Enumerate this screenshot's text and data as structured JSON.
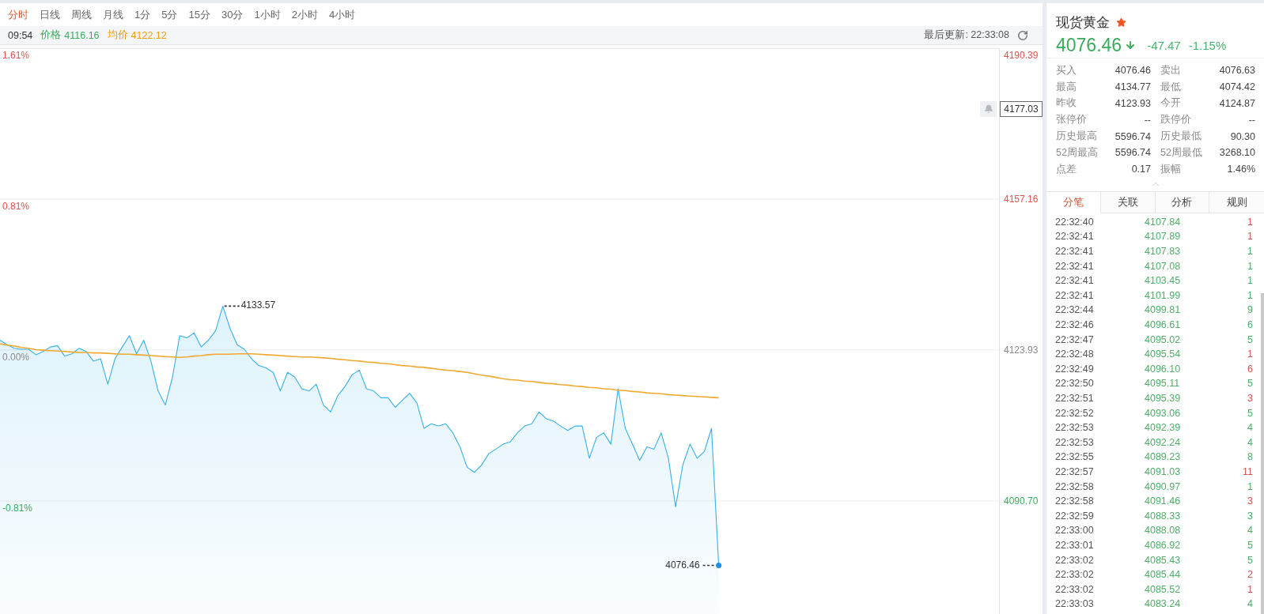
{
  "chart_tabs": [
    {
      "label": "分时",
      "selected": true
    },
    {
      "label": "日线",
      "selected": false
    },
    {
      "label": "周线",
      "selected": false
    },
    {
      "label": "月线",
      "selected": false
    },
    {
      "label": "1分",
      "selected": false
    },
    {
      "label": "5分",
      "selected": false
    },
    {
      "label": "15分",
      "selected": false
    },
    {
      "label": "30分",
      "selected": false
    },
    {
      "label": "1小时",
      "selected": false
    },
    {
      "label": "2小时",
      "selected": false
    },
    {
      "label": "4小时",
      "selected": false
    }
  ],
  "info_bar": {
    "time": "09:54",
    "readings": [
      "4116.16",
      "4122.12"
    ],
    "last_update": "最后更新: 22:33:08"
  },
  "chart": {
    "cursor_price": "4177.03",
    "percent_labels": [
      {
        "label": "1.61%",
        "color": "#e5514e"
      },
      {
        "label": "0.81%",
        "color": "#e5514e"
      },
      {
        "label": "0.00%",
        "color": "#8a8a8a"
      },
      {
        "label": "-0.81%",
        "color": "#3aac5d"
      }
    ],
    "chart_data": {
      "type": "line",
      "grid": true,
      "ylim": [
        4065.8,
        4190.39
      ],
      "yticks": [
        {
          "value": 4190.39,
          "label": "4190.39"
        },
        {
          "value": 4157.16,
          "label": "4157.16"
        },
        {
          "value": 4123.93,
          "label": "4123.93"
        },
        {
          "value": 4090.7,
          "label": "4090.70"
        }
      ],
      "series": [
        {
          "name": "价格",
          "color": "#38b0e8",
          "values": [
            4126.1,
            4125.1,
            4124.3,
            4124.1,
            4124.1,
            4122.9,
            4123.6,
            4124.6,
            4124.9,
            4122.6,
            4123.1,
            4124.3,
            4123.6,
            4121.5,
            4122.0,
            4116.4,
            4122.0,
            4124.6,
            4127.1,
            4123.1,
            4126.1,
            4121.5,
            4114.9,
            4111.8,
            4118.0,
            4127.1,
            4126.6,
            4127.7,
            4124.6,
            4126.1,
            4128.2,
            4133.6,
            4128.7,
            4125.1,
            4124.1,
            4122.0,
            4120.5,
            4120.0,
            4119.0,
            4114.9,
            4119.0,
            4118.0,
            4115.4,
            4114.9,
            4116.4,
            4111.8,
            4110.3,
            4113.9,
            4115.9,
            4118.5,
            4119.5,
            4115.4,
            4114.9,
            4113.4,
            4113.4,
            4111.3,
            4112.9,
            4114.4,
            4112.3,
            4106.7,
            4107.7,
            4107.2,
            4107.7,
            4105.7,
            4102.6,
            4098.1,
            4097.0,
            4098.6,
            4101.1,
            4102.1,
            4103.2,
            4103.7,
            4105.7,
            4107.2,
            4107.7,
            4110.3,
            4108.8,
            4108.3,
            4107.2,
            4106.2,
            4107.2,
            4107.2,
            4100.1,
            4104.7,
            4105.7,
            4103.2,
            4115.4,
            4106.7,
            4103.2,
            4099.6,
            4102.6,
            4102.1,
            4105.7,
            4100.1,
            4089.4,
            4098.6,
            4103.2,
            4100.1,
            4101.6,
            4106.7,
            4076.5,
            null,
            null,
            null,
            null,
            null,
            null,
            null,
            null,
            null,
            null,
            null,
            null,
            null,
            null,
            null,
            null,
            null,
            null,
            null,
            null,
            null,
            null,
            null,
            null,
            null,
            null,
            null,
            null,
            null,
            null,
            null,
            null,
            null,
            null,
            null,
            null,
            null,
            null,
            null
          ]
        },
        {
          "name": "均价",
          "color": "#f0a830",
          "values": [
            4125.3,
            4125.0,
            4124.8,
            4124.5,
            4124.3,
            4124.0,
            4123.9,
            4123.8,
            4123.7,
            4123.6,
            4123.5,
            4123.4,
            4123.4,
            4123.3,
            4123.3,
            4123.2,
            4123.1,
            4123.0,
            4123.0,
            4122.9,
            4122.8,
            4122.7,
            4122.6,
            4122.5,
            4122.4,
            4122.3,
            4122.4,
            4122.6,
            4122.7,
            4122.9,
            4123.0,
            4123.0,
            4123.0,
            4123.1,
            4123.1,
            4123.1,
            4123.0,
            4122.9,
            4122.8,
            4122.7,
            4122.6,
            4122.5,
            4122.4,
            4122.4,
            4122.3,
            4122.2,
            4122.1,
            4121.9,
            4121.8,
            4121.6,
            4121.5,
            4121.3,
            4121.2,
            4121.0,
            4120.9,
            4120.7,
            4120.5,
            4120.4,
            4120.2,
            4120.1,
            4119.9,
            4119.7,
            4119.5,
            4119.4,
            4119.2,
            4119.0,
            4118.7,
            4118.4,
            4118.2,
            4117.9,
            4117.6,
            4117.4,
            4117.3,
            4117.1,
            4117.0,
            4116.8,
            4116.6,
            4116.5,
            4116.3,
            4116.2,
            4116.0,
            4115.9,
            4115.7,
            4115.6,
            4115.4,
            4115.3,
            4115.1,
            4115.0,
            4114.8,
            4114.7,
            4114.5,
            4114.4,
            4114.3,
            4114.1,
            4114.0,
            4113.9,
            4113.8,
            4113.7,
            4113.6,
            4113.5,
            4113.4,
            null,
            null,
            null,
            null,
            null,
            null,
            null,
            null,
            null,
            null,
            null,
            null,
            null,
            null,
            null,
            null,
            null,
            null,
            null,
            null,
            null,
            null,
            null,
            null,
            null,
            null,
            null,
            null,
            null,
            null,
            null,
            null,
            null,
            null,
            null,
            null,
            null,
            null,
            null
          ]
        }
      ],
      "annotations": [
        "4133.57",
        "4076.46"
      ]
    }
  },
  "quote": {
    "name": "现货黄金",
    "favorite": true,
    "falling": true,
    "price": "4076.46",
    "change": "-47.47",
    "change_pct": "-1.15%"
  },
  "stat_rows": [
    [
      "买入",
      "4076.46",
      "卖出",
      "4076.63"
    ],
    [
      "最高",
      "4134.77",
      "最低",
      "4074.42"
    ],
    [
      "昨收",
      "4123.93",
      "今开",
      "4124.87"
    ],
    [
      "张停价",
      "--",
      "跌停价",
      "--"
    ],
    [
      "历史最高",
      "5596.74",
      "历史最低",
      "90.30"
    ],
    [
      "52周最高",
      "5596.74",
      "52周最低",
      "3268.10"
    ],
    [
      "点差",
      "0.17",
      "振幅",
      "1.46%"
    ]
  ],
  "panel_tabs": [
    {
      "label": "分笔",
      "selected": true
    },
    {
      "label": "关联",
      "selected": false
    },
    {
      "label": "分析",
      "selected": false
    },
    {
      "label": "规则",
      "selected": false
    }
  ],
  "trades": [
    {
      "time": "22:32:40",
      "price": "4107.84",
      "volume": "1",
      "color": "#cf5550"
    },
    {
      "time": "22:32:41",
      "price": "4107.89",
      "volume": "1",
      "color": "#cf5550"
    },
    {
      "time": "22:32:41",
      "price": "4107.83",
      "volume": "1",
      "color": "#4fae68"
    },
    {
      "time": "22:32:41",
      "price": "4107.08",
      "volume": "1",
      "color": "#4fae68"
    },
    {
      "time": "22:32:41",
      "price": "4103.45",
      "volume": "1",
      "color": "#4fae68"
    },
    {
      "time": "22:32:41",
      "price": "4101.99",
      "volume": "1",
      "color": "#4fae68"
    },
    {
      "time": "22:32:44",
      "price": "4099.81",
      "volume": "9",
      "color": "#4fae68"
    },
    {
      "time": "22:32:46",
      "price": "4096.61",
      "volume": "6",
      "color": "#4fae68"
    },
    {
      "time": "22:32:47",
      "price": "4095.02",
      "volume": "5",
      "color": "#4fae68"
    },
    {
      "time": "22:32:48",
      "price": "4095.54",
      "volume": "1",
      "color": "#cf5550"
    },
    {
      "time": "22:32:49",
      "price": "4096.10",
      "volume": "6",
      "color": "#cf5550"
    },
    {
      "time": "22:32:50",
      "price": "4095.11",
      "volume": "5",
      "color": "#4fae68"
    },
    {
      "time": "22:32:51",
      "price": "4095.39",
      "volume": "3",
      "color": "#cf5550"
    },
    {
      "time": "22:32:52",
      "price": "4093.06",
      "volume": "5",
      "color": "#4fae68"
    },
    {
      "time": "22:32:53",
      "price": "4092.39",
      "volume": "4",
      "color": "#4fae68"
    },
    {
      "time": "22:32:53",
      "price": "4092.24",
      "volume": "4",
      "color": "#4fae68"
    },
    {
      "time": "22:32:55",
      "price": "4089.23",
      "volume": "8",
      "color": "#4fae68"
    },
    {
      "time": "22:32:57",
      "price": "4091.03",
      "volume": "11",
      "color": "#cf5550"
    },
    {
      "time": "22:32:58",
      "price": "4090.97",
      "volume": "1",
      "color": "#4fae68"
    },
    {
      "time": "22:32:58",
      "price": "4091.46",
      "volume": "3",
      "color": "#cf5550"
    },
    {
      "time": "22:32:59",
      "price": "4088.33",
      "volume": "3",
      "color": "#4fae68"
    },
    {
      "time": "22:33:00",
      "price": "4088.08",
      "volume": "4",
      "color": "#4fae68"
    },
    {
      "time": "22:33:01",
      "price": "4086.92",
      "volume": "5",
      "color": "#4fae68"
    },
    {
      "time": "22:33:02",
      "price": "4085.43",
      "volume": "5",
      "color": "#4fae68"
    },
    {
      "time": "22:33:02",
      "price": "4085.44",
      "volume": "2",
      "color": "#cf5550"
    },
    {
      "time": "22:33:02",
      "price": "4085.52",
      "volume": "1",
      "color": "#cf5550"
    },
    {
      "time": "22:33:03",
      "price": "4083.24",
      "volume": "4",
      "color": "#4fae68"
    }
  ]
}
